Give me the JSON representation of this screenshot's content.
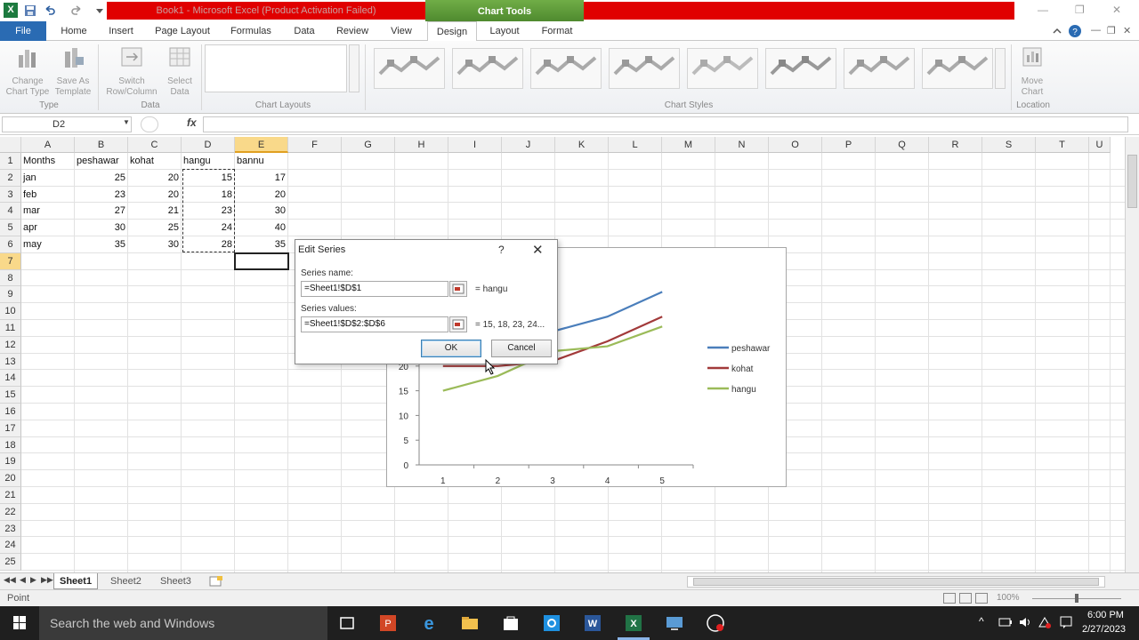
{
  "titlebar": {
    "title": "Book1 - Microsoft Excel (Product Activation Failed)",
    "context_label": "Chart Tools"
  },
  "tabs": {
    "file": "File",
    "home": "Home",
    "insert": "Insert",
    "page_layout": "Page Layout",
    "formulas": "Formulas",
    "data": "Data",
    "review": "Review",
    "view": "View",
    "design": "Design",
    "layout": "Layout",
    "format": "Format"
  },
  "ribbon": {
    "change_chart_type": [
      "Change",
      "Chart Type"
    ],
    "save_as_template": [
      "Save As",
      "Template"
    ],
    "switch_row_column": [
      "Switch",
      "Row/Column"
    ],
    "select_data": [
      "Select",
      "Data"
    ],
    "move_chart": [
      "Move",
      "Chart"
    ],
    "groups": {
      "type": "Type",
      "data": "Data",
      "chart_layouts": "Chart Layouts",
      "chart_styles": "Chart Styles",
      "location": "Location"
    }
  },
  "formula_bar": {
    "name_box": "D2",
    "fx": "fx",
    "formula": ""
  },
  "grid": {
    "columns": [
      "A",
      "B",
      "C",
      "D",
      "E",
      "F",
      "G",
      "H",
      "I",
      "J",
      "K",
      "L",
      "M",
      "N",
      "O",
      "P",
      "Q",
      "R",
      "S",
      "T",
      "U"
    ],
    "rows": [
      "1",
      "2",
      "3",
      "4",
      "5",
      "6",
      "7",
      "8",
      "9",
      "10",
      "11",
      "12",
      "13",
      "14",
      "15",
      "16",
      "17",
      "18",
      "19",
      "20",
      "21",
      "22",
      "23",
      "24",
      "25"
    ],
    "headers": [
      "Months",
      "peshawar",
      "kohat",
      "hangu",
      "bannu"
    ],
    "data": [
      [
        "jan",
        "25",
        "20",
        "15",
        "17"
      ],
      [
        "feb",
        "23",
        "20",
        "18",
        "20"
      ],
      [
        "mar",
        "27",
        "21",
        "23",
        "30"
      ],
      [
        "apr",
        "30",
        "25",
        "24",
        "40"
      ],
      [
        "may",
        "35",
        "30",
        "28",
        "35"
      ]
    ]
  },
  "chart_data": {
    "type": "line",
    "x": [
      1,
      2,
      3,
      4,
      5
    ],
    "series": [
      {
        "name": "peshawar",
        "values": [
          25,
          23,
          27,
          30,
          35
        ],
        "color": "#4a7ebb"
      },
      {
        "name": "kohat",
        "values": [
          20,
          20,
          21,
          25,
          30
        ],
        "color": "#a23a3a"
      },
      {
        "name": "hangu",
        "values": [
          15,
          18,
          23,
          24,
          28
        ],
        "color": "#9bbb59"
      }
    ],
    "y_ticks": [
      "0",
      "5",
      "10",
      "15",
      "20"
    ],
    "x_ticks": [
      "1",
      "2",
      "3",
      "4",
      "5"
    ],
    "ylim": [
      0,
      40
    ],
    "legend": "right",
    "grid": false
  },
  "dialog": {
    "title": "Edit Series",
    "help": "?",
    "close": "✕",
    "series_name_label": "Series name:",
    "series_name_value": "=Sheet1!$D$1",
    "series_name_result": "= hangu",
    "series_values_label": "Series values:",
    "series_values_value": "=Sheet1!$D$2:$D$6",
    "series_values_result": "= 15, 18, 23, 24...",
    "ok": "OK",
    "cancel": "Cancel"
  },
  "sheets": [
    "Sheet1",
    "Sheet2",
    "Sheet3"
  ],
  "status": {
    "mode": "Point",
    "zoom": "100%"
  },
  "taskbar": {
    "search_placeholder": "Search the web and Windows",
    "time": "6:00 PM",
    "date": "2/27/2023"
  }
}
